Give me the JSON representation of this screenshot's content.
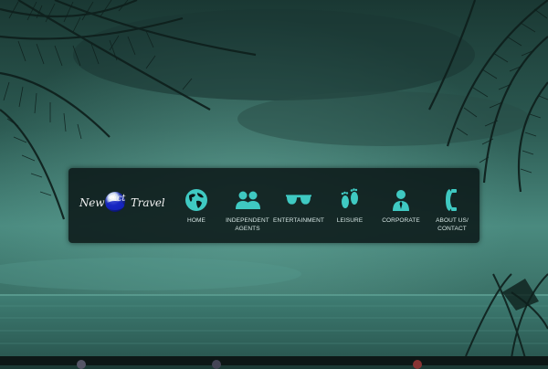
{
  "brand": {
    "logo_part1": "New",
    "logo_part2": "Act",
    "logo_part3": "Travel"
  },
  "nav": {
    "items": [
      {
        "label": "HOME",
        "icon": "globe-icon"
      },
      {
        "label": "INDEPENDENT\nAGENTS",
        "icon": "people-icon"
      },
      {
        "label": "ENTERTAINMENT",
        "icon": "sunglasses-icon"
      },
      {
        "label": "LEISURE",
        "icon": "footprints-icon"
      },
      {
        "label": "CORPORATE",
        "icon": "businessman-icon"
      },
      {
        "label": "ABOUT US/\nCONTACT",
        "icon": "phone-icon"
      }
    ]
  },
  "colors": {
    "accent": "#3fc9c2",
    "navbar_bg": "#0a1616",
    "scene_tint": "#1f4640"
  }
}
